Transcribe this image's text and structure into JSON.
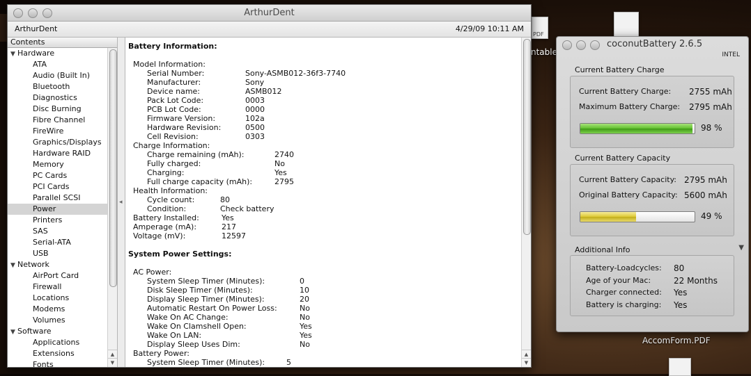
{
  "desktop": {
    "label_partial": "ntable",
    "label_accom": "AccomForm.PDF",
    "pdf_badge": "PDF"
  },
  "profiler": {
    "window_title": "ArthurDent",
    "computer_name": "ArthurDent",
    "timestamp": "4/29/09 10:11 AM",
    "sidebar_header": "Contents",
    "tree": [
      {
        "type": "cat",
        "label": "Hardware"
      },
      {
        "type": "item",
        "label": "ATA"
      },
      {
        "type": "item",
        "label": "Audio (Built In)"
      },
      {
        "type": "item",
        "label": "Bluetooth"
      },
      {
        "type": "item",
        "label": "Diagnostics"
      },
      {
        "type": "item",
        "label": "Disc Burning"
      },
      {
        "type": "item",
        "label": "Fibre Channel"
      },
      {
        "type": "item",
        "label": "FireWire"
      },
      {
        "type": "item",
        "label": "Graphics/Displays"
      },
      {
        "type": "item",
        "label": "Hardware RAID"
      },
      {
        "type": "item",
        "label": "Memory"
      },
      {
        "type": "item",
        "label": "PC Cards"
      },
      {
        "type": "item",
        "label": "PCI Cards"
      },
      {
        "type": "item",
        "label": "Parallel SCSI"
      },
      {
        "type": "item",
        "label": "Power",
        "selected": true
      },
      {
        "type": "item",
        "label": "Printers"
      },
      {
        "type": "item",
        "label": "SAS"
      },
      {
        "type": "item",
        "label": "Serial-ATA"
      },
      {
        "type": "item",
        "label": "USB"
      },
      {
        "type": "cat",
        "label": "Network"
      },
      {
        "type": "item",
        "label": "AirPort Card"
      },
      {
        "type": "item",
        "label": "Firewall"
      },
      {
        "type": "item",
        "label": "Locations"
      },
      {
        "type": "item",
        "label": "Modems"
      },
      {
        "type": "item",
        "label": "Volumes"
      },
      {
        "type": "cat",
        "label": "Software"
      },
      {
        "type": "item",
        "label": "Applications"
      },
      {
        "type": "item",
        "label": "Extensions"
      },
      {
        "type": "item",
        "label": "Fonts"
      }
    ],
    "content": [
      {
        "text": "Battery Information:",
        "bold": true,
        "indent": 0
      },
      {
        "text": "",
        "indent": 0
      },
      {
        "text": "Model Information:",
        "indent": 1
      },
      {
        "text": "Serial Number:",
        "indent": 2,
        "value": "Sony-ASMB012-36f3-7740",
        "col": 1
      },
      {
        "text": "Manufacturer:",
        "indent": 2,
        "value": "Sony",
        "col": 1
      },
      {
        "text": "Device name:",
        "indent": 2,
        "value": "ASMB012",
        "col": 1
      },
      {
        "text": "Pack Lot Code:",
        "indent": 2,
        "value": "0003",
        "col": 1
      },
      {
        "text": "PCB Lot Code:",
        "indent": 2,
        "value": "0000",
        "col": 1
      },
      {
        "text": "Firmware Version:",
        "indent": 2,
        "value": "102a",
        "col": 1
      },
      {
        "text": "Hardware Revision:",
        "indent": 2,
        "value": "0500",
        "col": 1
      },
      {
        "text": "Cell Revision:",
        "indent": 2,
        "value": "0303",
        "col": 1
      },
      {
        "text": "Charge Information:",
        "indent": 1
      },
      {
        "text": "Charge remaining (mAh):",
        "indent": 2,
        "value": "2740",
        "col": 2
      },
      {
        "text": "Fully charged:",
        "indent": 2,
        "value": "No",
        "col": 2
      },
      {
        "text": "Charging:",
        "indent": 2,
        "value": "Yes",
        "col": 2
      },
      {
        "text": "Full charge capacity (mAh):",
        "indent": 2,
        "value": "2795",
        "col": 2
      },
      {
        "text": "Health Information:",
        "indent": 1
      },
      {
        "text": "Cycle count:",
        "indent": 2,
        "value": "80",
        "col": 3
      },
      {
        "text": "Condition:",
        "indent": 2,
        "value": "Check battery",
        "col": 4
      },
      {
        "text": "Battery Installed:",
        "indent": 1,
        "value": "Yes",
        "col": 5
      },
      {
        "text": "Amperage (mA):",
        "indent": 1,
        "value": "217",
        "col": 5
      },
      {
        "text": "Voltage (mV):",
        "indent": 1,
        "value": "12597",
        "col": 5
      },
      {
        "text": "",
        "indent": 0
      },
      {
        "text": "System Power Settings:",
        "bold": true,
        "indent": 0
      },
      {
        "text": "",
        "indent": 0
      },
      {
        "text": "AC Power:",
        "indent": 1
      },
      {
        "text": "System Sleep Timer (Minutes):",
        "indent": 2,
        "value": "0",
        "col": 6
      },
      {
        "text": "Disk Sleep Timer (Minutes):",
        "indent": 2,
        "value": "10",
        "col": 6
      },
      {
        "text": "Display Sleep Timer (Minutes):",
        "indent": 2,
        "value": "20",
        "col": 6
      },
      {
        "text": "Automatic Restart On Power Loss:",
        "indent": 2,
        "value": "No",
        "col": 6
      },
      {
        "text": "Wake On AC Change:",
        "indent": 2,
        "value": "No",
        "col": 6
      },
      {
        "text": "Wake On Clamshell Open:",
        "indent": 2,
        "value": "Yes",
        "col": 6
      },
      {
        "text": "Wake On LAN:",
        "indent": 2,
        "value": "Yes",
        "col": 6
      },
      {
        "text": "Display Sleep Uses Dim:",
        "indent": 2,
        "value": "No",
        "col": 6
      },
      {
        "text": "Battery Power:",
        "indent": 1
      },
      {
        "text": "System Sleep Timer (Minutes):",
        "indent": 2,
        "value": "5",
        "col": 7
      }
    ]
  },
  "coconut": {
    "title": "coconutBattery 2.6.5",
    "cpu": "INTEL",
    "charge_section": "Current Battery Charge",
    "current_charge_label": "Current Battery Charge:",
    "current_charge_value": "2755 mAh",
    "max_charge_label": "Maximum Battery Charge:",
    "max_charge_value": "2795 mAh",
    "charge_percent_label": "98 %",
    "charge_fraction": 0.98,
    "capacity_section": "Current Battery Capacity",
    "current_capacity_label": "Current Battery Capacity:",
    "current_capacity_value": "2795 mAh",
    "original_capacity_label": "Original Battery Capacity:",
    "original_capacity_value": "5600 mAh",
    "capacity_percent_label": "49 %",
    "capacity_fraction": 0.49,
    "info_section": "Additional Info",
    "info": [
      {
        "label": "Battery-Loadcycles:",
        "value": "80"
      },
      {
        "label": "Age of your Mac:",
        "value": "22 Months"
      },
      {
        "label": "Charger connected:",
        "value": "Yes"
      },
      {
        "label": "Battery is charging:",
        "value": "Yes"
      }
    ],
    "colors": {
      "charge_bar": "#5fbf2e",
      "capacity_bar": "#dcc832"
    }
  }
}
